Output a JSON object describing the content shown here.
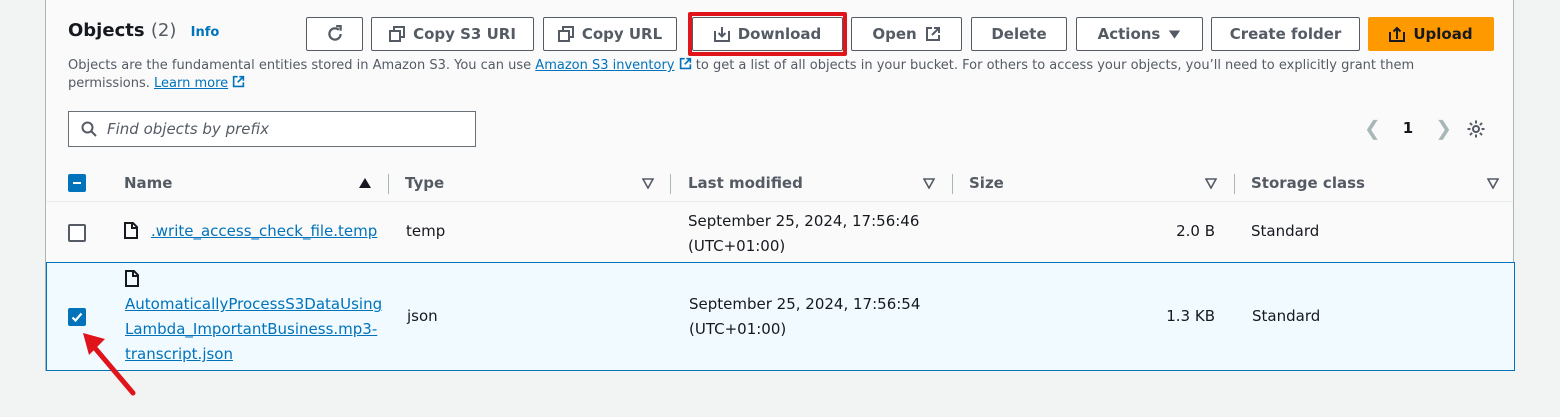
{
  "header": {
    "title": "Objects",
    "count": "(2)",
    "info": "Info"
  },
  "toolbar": {
    "copy_s3_uri": "Copy S3 URI",
    "copy_url": "Copy URL",
    "download": "Download",
    "open": "Open",
    "delete": "Delete",
    "actions": "Actions",
    "create_folder": "Create folder",
    "upload": "Upload"
  },
  "description": {
    "part1": "Objects are the fundamental entities stored in Amazon S3. You can use ",
    "inventory_link": "Amazon S3 inventory",
    "part2": " to get a list of all objects in your bucket. For others to access your objects, you’ll need to explicitly grant them permissions. ",
    "learn_more": "Learn more"
  },
  "search": {
    "placeholder": "Find objects by prefix"
  },
  "pagination": {
    "page": "1"
  },
  "table": {
    "columns": [
      "Name",
      "Type",
      "Last modified",
      "Size",
      "Storage class"
    ],
    "rows": [
      {
        "name": ".write_access_check_file.temp",
        "type": "temp",
        "modified_line1": "September 25, 2024, 17:56:46",
        "modified_line2": "(UTC+01:00)",
        "size": "2.0 B",
        "storage_class": "Standard",
        "selected": false
      },
      {
        "name_line1": "AutomaticallyProcessS3DataUsing",
        "name_line2": "Lambda_ImportantBusiness.mp3-",
        "name_line3": "transcript.json",
        "type": "json",
        "modified_line1": "September 25, 2024, 17:56:54",
        "modified_line2": "(UTC+01:00)",
        "size": "1.3 KB",
        "storage_class": "Standard",
        "selected": true
      }
    ]
  },
  "colors": {
    "accent": "#0073bb",
    "upload": "#ff9900",
    "highlight": "#e0141b"
  }
}
